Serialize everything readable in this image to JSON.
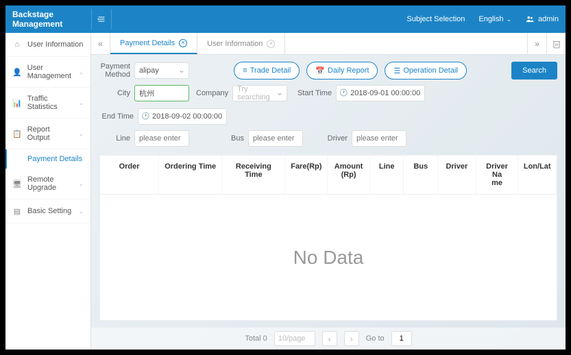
{
  "header": {
    "brand": "Backstage Management",
    "subject_selection": "Subject Selection",
    "language": "English",
    "username": "admin"
  },
  "sidebar": {
    "items": [
      {
        "label": "User Information",
        "icon": "home"
      },
      {
        "label": "User Management",
        "icon": "user"
      },
      {
        "label": "Traffic Statistics",
        "icon": "stats"
      },
      {
        "label": "Report Output",
        "icon": "report"
      },
      {
        "label": "Remote Upgrade",
        "icon": "monitor"
      },
      {
        "label": "Basic Setting",
        "icon": "settings"
      }
    ],
    "sub_item": "Payment Details"
  },
  "tabs": {
    "items": [
      {
        "label": "Payment Details",
        "active": true
      },
      {
        "label": "User Information",
        "active": false
      }
    ]
  },
  "filters": {
    "payment_method": {
      "label": "Payment\nMethod",
      "value": "alipay"
    },
    "city": {
      "label": "City",
      "value": "杭州"
    },
    "company": {
      "label": "Company",
      "placeholder": "Try searching"
    },
    "start_time": {
      "label": "Start Time",
      "value": "2018-09-01 00:00:00"
    },
    "end_time": {
      "label": "End Time",
      "value": "2018-09-02 00:00:00"
    },
    "line": {
      "label": "Line",
      "placeholder": "please enter"
    },
    "bus": {
      "label": "Bus",
      "placeholder": "please enter"
    },
    "driver": {
      "label": "Driver",
      "placeholder": "please enter"
    }
  },
  "buttons": {
    "trade_detail": "Trade Detail",
    "daily_report": "Daily Report",
    "operation_detail": "Operation Detail",
    "search": "Search"
  },
  "table": {
    "columns": [
      "Order",
      "Ordering Time",
      "Receiving Time",
      "Fare(Rp)",
      "Amount(Rp)",
      "Line",
      "Bus",
      "Driver",
      "Driver Name",
      "Lon/Lat"
    ],
    "no_data_text": "No Data"
  },
  "pager": {
    "total_label": "Total 0",
    "per_page": "10/page",
    "goto_label": "Go to",
    "goto_value": "1"
  }
}
